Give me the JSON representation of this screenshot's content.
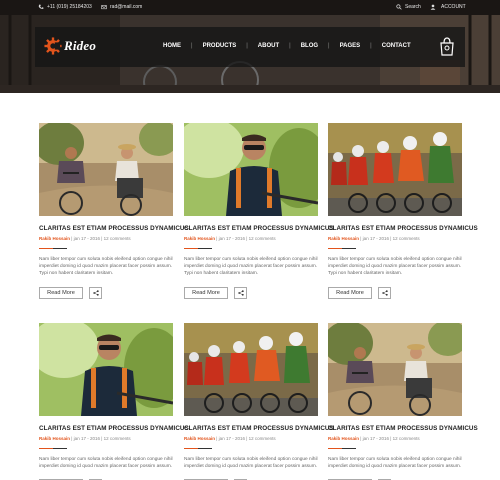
{
  "topbar": {
    "phone": "+11 (019) 25184203",
    "email": "rad@mail.com",
    "search": "Search",
    "account": "ACCOUNT"
  },
  "brand": {
    "name": "Rideo",
    "accent": "#e2541c"
  },
  "nav": [
    "HOME",
    "PRODUCTS",
    "ABOUT",
    "BLOG",
    "PAGES",
    "CONTACT"
  ],
  "icons": {
    "phone": "phone-icon",
    "email": "envelope-icon",
    "search": "search-icon",
    "account": "user-icon",
    "cart": "shopping-bag-icon",
    "share": "share-icon"
  },
  "posts": [
    {
      "image": "couple-riding-bikes",
      "title": "CLARITAS EST ETIAM PROCESSUS DYNAMICUS",
      "author": "Rakib Hossain",
      "meta": " | jan 17 - 2016 | 12 comments",
      "excerpt": "Nam liber tempor cum soluta nobis eleifend option congue nihil imperdiet doming id quod mazim placerat facer possim assum. Typi non habent claritatem insitam.",
      "button": "Read More"
    },
    {
      "image": "man-with-sunglasses",
      "title": "CLARITAS EST ETIAM PROCESSUS DYNAMICUS",
      "author": "Rakib Hossain",
      "meta": " | jan 17 - 2016 | 12 comments",
      "excerpt": "Nam liber tempor cum soluta nobis eleifend option congue nihil imperdiet doming id quod mazim placerat facer possim assum. Typi non habent claritatem insitam.",
      "button": "Read More"
    },
    {
      "image": "cycling-race",
      "title": "CLARITAS EST ETIAM PROCESSUS DYNAMICUS",
      "author": "Rakib Hossain",
      "meta": " | jan 17 - 2016 | 12 comments",
      "excerpt": "Nam liber tempor cum soluta nobis eleifend option congue nihil imperdiet doming id quod mazim placerat facer possim assum. Typi non habent claritatem insitam.",
      "button": "Read More"
    },
    {
      "image": "man-with-sunglasses",
      "title": "CLARITAS EST ETIAM PROCESSUS DYNAMICUS",
      "author": "Rakib Hossain",
      "meta": " | jan 17 - 2016 | 12 comments",
      "excerpt": "Nam liber tempor cum soluta nobis eleifend option congue nihil imperdiet doming id quod mazim placerat facer possim assum.",
      "button": "Read More"
    },
    {
      "image": "cycling-race",
      "title": "CLARITAS EST ETIAM PROCESSUS DYNAMICUS",
      "author": "Rakib Hossain",
      "meta": " | jan 17 - 2016 | 12 comments",
      "excerpt": "Nam liber tempor cum soluta nobis eleifend option congue nihil imperdiet doming id quod mazim placerat facer possim assum.",
      "button": "Read More"
    },
    {
      "image": "couple-riding-bikes",
      "title": "CLARITAS EST ETIAM PROCESSUS DYNAMICUS",
      "author": "Rakib Hossain",
      "meta": " | jan 17 - 2016 | 12 comments",
      "excerpt": "Nam liber tempor cum soluta nobis eleifend option congue nihil imperdiet doming id quod mazim placerat facer possim assum.",
      "button": "Read More"
    }
  ]
}
